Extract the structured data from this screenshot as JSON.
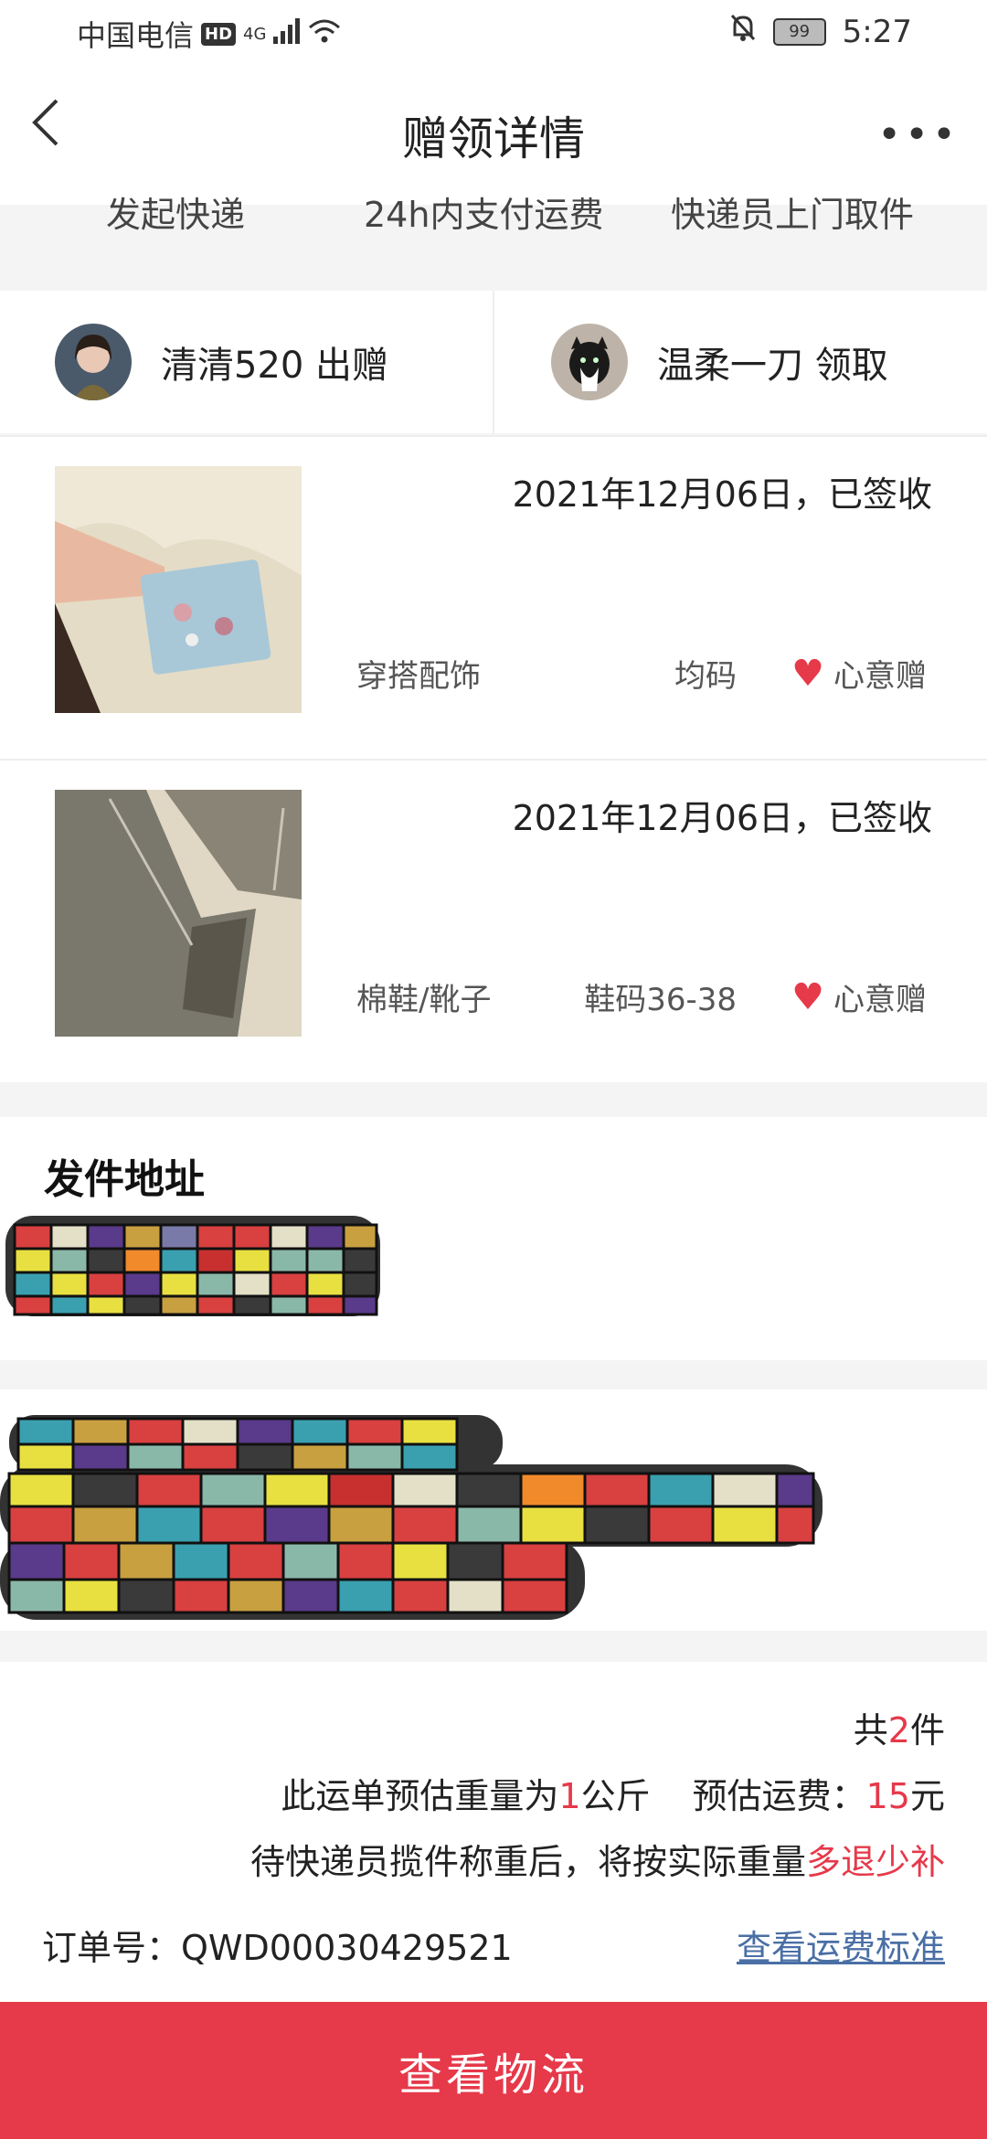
{
  "status_bar": {
    "carrier": "中国电信",
    "hd": "HD",
    "network": "4G",
    "battery": "99",
    "time": "5:27"
  },
  "header": {
    "title": "赠领详情"
  },
  "steps": [
    "发起快递",
    "24h内支付运费",
    "快递员上门取件"
  ],
  "donor": {
    "name": "清清520 出赠"
  },
  "receiver": {
    "name": "温柔一刀 领取"
  },
  "items": [
    {
      "date": "2021年12月06日，已签收",
      "category": "穿搭配饰",
      "size": "均码",
      "tag": "心意赠"
    },
    {
      "date": "2021年12月06日，已签收",
      "category": "棉鞋/靴子",
      "size": "鞋码36-38",
      "tag": "心意赠"
    }
  ],
  "sender_address": {
    "title": "发件地址"
  },
  "summary": {
    "count_prefix": "共",
    "count": "2",
    "count_suffix": "件",
    "weight_prefix": "此运单预估重量为",
    "weight": "1",
    "weight_suffix": "公斤",
    "fee_prefix": "预估运费：",
    "fee": "15",
    "fee_suffix": "元",
    "note_prefix": "待快递员揽件称重后，将按实际重量",
    "note_highlight": "多退少补",
    "order_label": "订单号：QWD00030429521",
    "fee_standard_link": "查看运费标准"
  },
  "bottom_button": "查看物流",
  "colors": {
    "accent": "#e6394a",
    "link": "#4a6fa5"
  }
}
